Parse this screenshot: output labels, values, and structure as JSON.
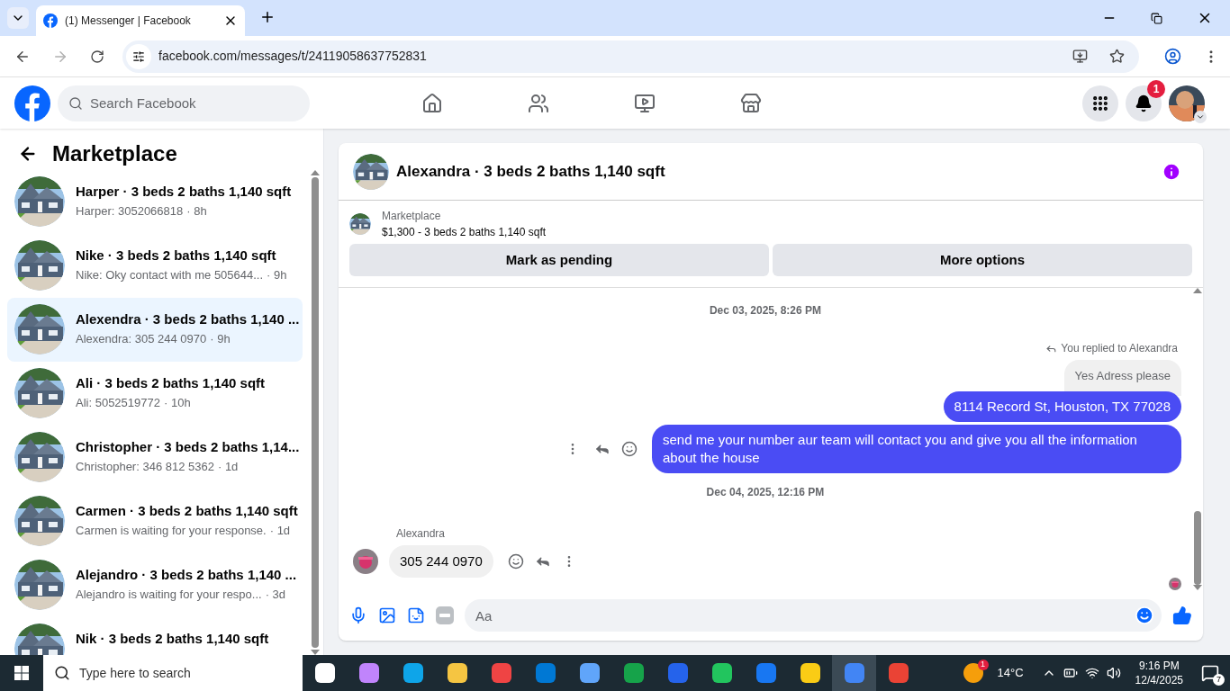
{
  "browser": {
    "tab_title": "(1) Messenger | Facebook",
    "url": "facebook.com/messages/t/24119058637752831"
  },
  "header": {
    "search_placeholder": "Search Facebook",
    "notification_count": "1"
  },
  "sidebar": {
    "title": "Marketplace",
    "conversations": [
      {
        "title": "Harper · 3 beds 2 baths 1,140 sqft",
        "preview": "Harper: 3052066818",
        "time": "· 8h",
        "selected": false
      },
      {
        "title": "Nike · 3 beds 2 baths 1,140 sqft",
        "preview": "Nike: Oky contact with me 505644...",
        "time": "· 9h",
        "selected": false
      },
      {
        "title": "Alexendra · 3 beds 2 baths 1,140 ...",
        "preview": "Alexendra: 305 244 0970",
        "time": "· 9h",
        "selected": true
      },
      {
        "title": "Ali · 3 beds 2 baths 1,140 sqft",
        "preview": "Ali: 5052519772",
        "time": "· 10h",
        "selected": false
      },
      {
        "title": "Christopher · 3 beds 2 baths 1,14...",
        "preview": "Christopher: 346 812 5362",
        "time": "· 1d",
        "selected": false
      },
      {
        "title": "Carmen · 3 beds 2 baths 1,140 sqft",
        "preview": "Carmen is waiting for your response.",
        "time": "· 1d",
        "selected": false
      },
      {
        "title": "Alejandro · 3 beds 2 baths 1,140 ...",
        "preview": "Alejandro is waiting for your respo...",
        "time": "· 3d",
        "selected": false
      },
      {
        "title": "Nik · 3 beds 2 baths 1,140 sqft",
        "selected": false
      }
    ]
  },
  "chat": {
    "title": "Alexandra · 3 beds 2 baths 1,140 sqft",
    "listing": {
      "label": "Marketplace",
      "summary": "$1,300 - 3 beds 2 baths 1,140 sqft",
      "buttons": [
        "Mark as pending",
        "More options"
      ]
    },
    "messages": [
      {
        "kind": "timestamp",
        "text": "Dec 03, 2025, 8:26 PM"
      },
      {
        "kind": "reply_note",
        "text": "You replied to Alexandra"
      },
      {
        "kind": "quoted",
        "text": "Yes Adress please"
      },
      {
        "kind": "outgoing",
        "text": "8114 Record St, Houston, TX 77028",
        "actions": false
      },
      {
        "kind": "outgoing",
        "text": "send me your number aur team will contact you and give you all the information about the house",
        "actions": true
      },
      {
        "kind": "timestamp",
        "text": "Dec 04, 2025, 12:16 PM"
      },
      {
        "kind": "incoming",
        "sender": "Alexandra",
        "text": "305 244 0970",
        "actions": true
      }
    ],
    "composer_placeholder": "Aa"
  },
  "taskbar": {
    "search_placeholder": "Type here to search",
    "apps": [
      {
        "selected": false
      },
      {
        "selected": false
      },
      {
        "selected": false
      },
      {
        "selected": false
      },
      {
        "selected": false
      },
      {
        "selected": false
      },
      {
        "selected": false
      },
      {
        "selected": false
      },
      {
        "selected": false
      },
      {
        "selected": false
      },
      {
        "selected": false
      },
      {
        "selected": false
      },
      {
        "selected": true
      },
      {
        "selected": false
      }
    ],
    "weather_badge": "1",
    "temperature": "14°C",
    "time": "9:16 PM",
    "date": "12/4/2025",
    "notifications": "7"
  }
}
